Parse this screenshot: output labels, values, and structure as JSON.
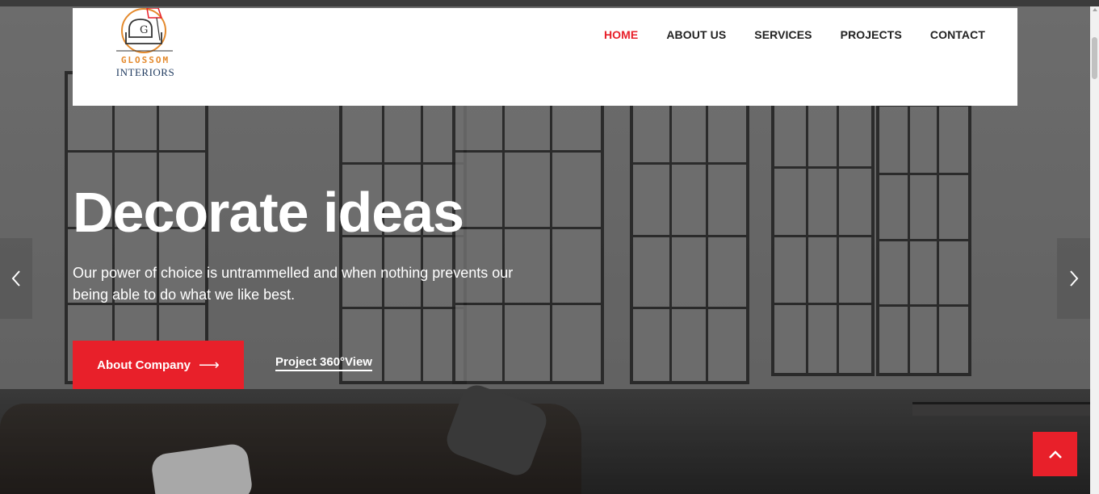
{
  "brand": {
    "line1": "GLOSSOM",
    "line2": "INTERIORS",
    "logo_icon": "armchair-icon"
  },
  "nav": {
    "items": [
      {
        "label": "HOME",
        "active": true
      },
      {
        "label": "ABOUT US",
        "active": false
      },
      {
        "label": "SERVICES",
        "active": false
      },
      {
        "label": "PROJECTS",
        "active": false
      },
      {
        "label": "CONTACT",
        "active": false
      }
    ]
  },
  "hero": {
    "title": "Decorate ideas",
    "subtitle": "Our power of choice is untrammelled and when nothing prevents our being able to do what we like best.",
    "primary_button": "About Company",
    "primary_button_icon": "long-arrow-right-icon",
    "secondary_link": "Project 360°View",
    "prev_icon": "chevron-left-icon",
    "next_icon": "chevron-right-icon"
  },
  "back_to_top_icon": "chevron-up-icon",
  "colors": {
    "accent": "#e8202a",
    "logo_orange": "#e48a2d",
    "logo_navy": "#1f3a5f",
    "nav_text": "#222222"
  }
}
